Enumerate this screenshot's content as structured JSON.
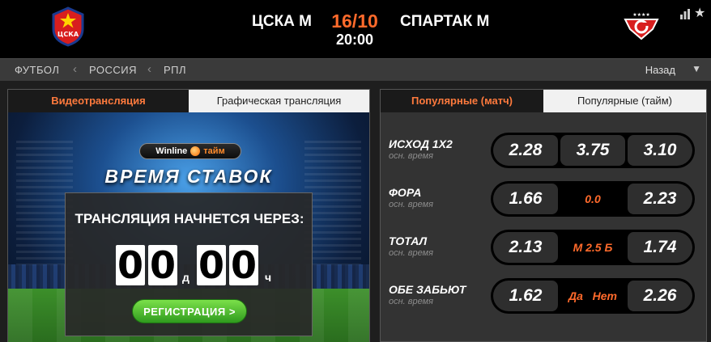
{
  "header": {
    "home_team": "ЦСКА М",
    "score": "16/10",
    "time": "20:00",
    "away_team": "СПАРТАК М",
    "home_logo_text": "ЦСКА",
    "away_logo_stars": "★★★★"
  },
  "breadcrumb": {
    "items": [
      "ФУТБОЛ",
      "РОССИЯ",
      "РПЛ"
    ],
    "back_label": "Назад"
  },
  "left_panel": {
    "tabs": [
      "Видеотрансляция",
      "Графическая трансляция"
    ],
    "winline_text": "Winline",
    "winline_sub": "тайм",
    "bet_time_title": "ВРЕМЯ СТАВОК",
    "countdown_title": "ТРАНСЛЯЦИЯ НАЧНЕТСЯ ЧЕРЕЗ:",
    "days_digits": [
      "0",
      "0"
    ],
    "days_unit": "д",
    "hours_digits": [
      "0",
      "0"
    ],
    "hours_unit": "ч",
    "register_label": "РЕГИСТРАЦИЯ >"
  },
  "right_panel": {
    "tabs": [
      "Популярные (матч)",
      "Популярные (тайм)"
    ],
    "markets": [
      {
        "name": "ИСХОД 1Х2",
        "sub": "осн. время",
        "left": "2.28",
        "mid": "3.75",
        "right": "3.10"
      },
      {
        "name": "ФОРА",
        "sub": "осн. время",
        "left": "1.66",
        "mid": "0.0",
        "right": "2.23"
      },
      {
        "name": "ТОТАЛ",
        "sub": "осн. время",
        "left": "2.13",
        "mid": "М 2.5 Б",
        "right": "1.74"
      },
      {
        "name": "ОБЕ ЗАБЬЮТ",
        "sub": "осн. время",
        "left": "1.62",
        "mid": "Да   Нет",
        "right": "2.26"
      }
    ]
  },
  "colors": {
    "accent": "#ff6a2b",
    "register_green": "#2f9b1e",
    "header_bg": "#000000"
  }
}
